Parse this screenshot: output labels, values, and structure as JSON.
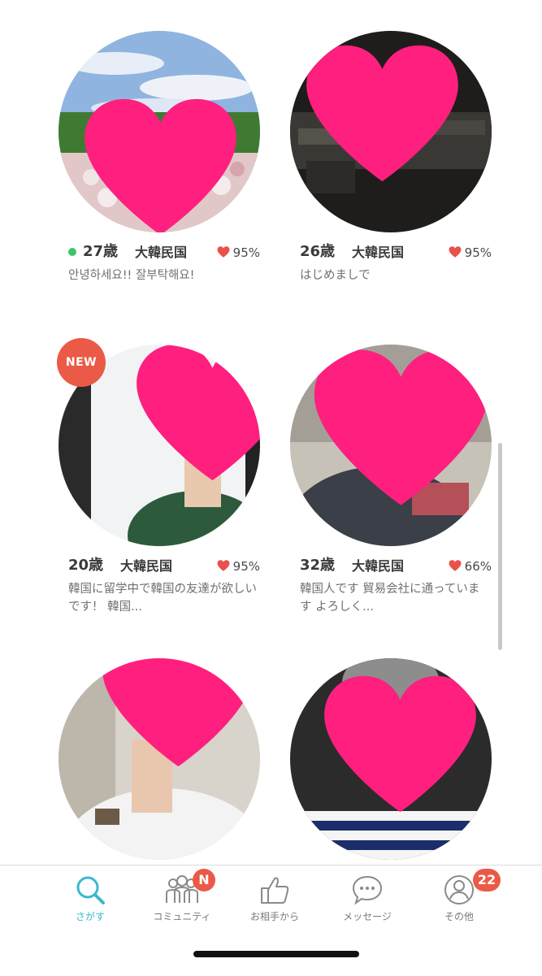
{
  "colors": {
    "accent": "#39b9cc",
    "heart_pink": "#ff1f7e",
    "match_heart": "#e8524a",
    "badge": "#ea5a47",
    "online": "#3cc469"
  },
  "profiles": [
    {
      "age": "27歳",
      "country": "大韓民国",
      "match": "95%",
      "bio": "안녕하세요!! 잘부탁해요!",
      "online": true,
      "is_new": false
    },
    {
      "age": "26歳",
      "country": "大韓民国",
      "match": "95%",
      "bio": "はじめましで",
      "online": false,
      "is_new": false
    },
    {
      "age": "20歳",
      "country": "大韓民国",
      "match": "95%",
      "bio": "韓国に留学中で韓国の友達が欲しいです！ 韓国...",
      "online": false,
      "is_new": true
    },
    {
      "age": "32歳",
      "country": "大韓民国",
      "match": "66%",
      "bio": "韓国人です 貿易会社に通っています よろしく...",
      "online": false,
      "is_new": false
    }
  ],
  "new_badge": "NEW",
  "tabbar": {
    "tabs": [
      {
        "label": "さがす",
        "icon": "search-icon",
        "active": true
      },
      {
        "label": "コミュニティ",
        "icon": "community-icon",
        "active": false,
        "badge": "N"
      },
      {
        "label": "お相手から",
        "icon": "thumbs-up-icon",
        "active": false
      },
      {
        "label": "メッセージ",
        "icon": "chat-icon",
        "active": false
      },
      {
        "label": "その他",
        "icon": "user-icon",
        "active": false,
        "badge": "22"
      }
    ]
  }
}
